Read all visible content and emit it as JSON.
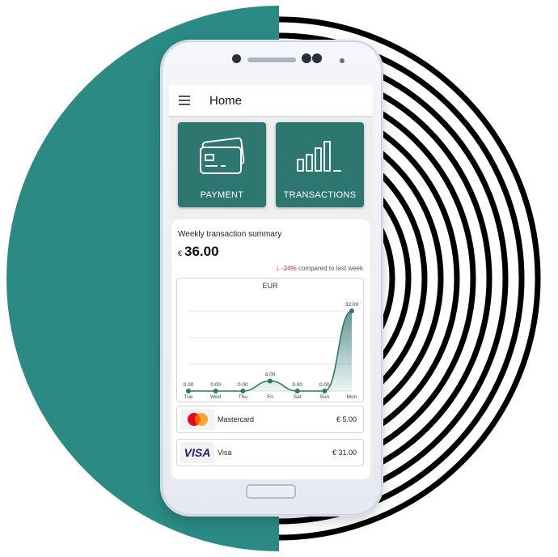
{
  "app": {
    "title": "Home"
  },
  "tiles": [
    {
      "label": "PAYMENT",
      "icon": "credit-card-icon"
    },
    {
      "label": "TRANSACTIONS",
      "icon": "bar-chart-icon"
    }
  ],
  "summary": {
    "title": "Weekly transaction summary",
    "currency_symbol": "€",
    "total": "36.00",
    "change_pct": "-24%",
    "change_text": "compared to last week"
  },
  "chart_data": {
    "type": "area",
    "title": "EUR",
    "categories": [
      "Tue",
      "Wed",
      "Thu",
      "Fri",
      "Sat",
      "Sun",
      "Mon"
    ],
    "values": [
      0,
      0,
      0,
      4,
      0,
      0,
      32
    ],
    "value_labels": [
      "0.00",
      "0.00",
      "0.00",
      "4.00",
      "0.00",
      "0.00",
      "32.00"
    ],
    "ylim": [
      0,
      32
    ],
    "grid": true,
    "color": "#2e7670"
  },
  "payments": [
    {
      "name": "Mastercard",
      "amount": "€ 5.00",
      "icon": "mastercard-logo"
    },
    {
      "name": "Visa",
      "amount": "€ 31.00",
      "icon": "visa-logo",
      "logo_text": "VISA"
    }
  ],
  "colors": {
    "accent": "#2e7670",
    "background_circle": "#2b8a84",
    "negative": "#c62828"
  }
}
